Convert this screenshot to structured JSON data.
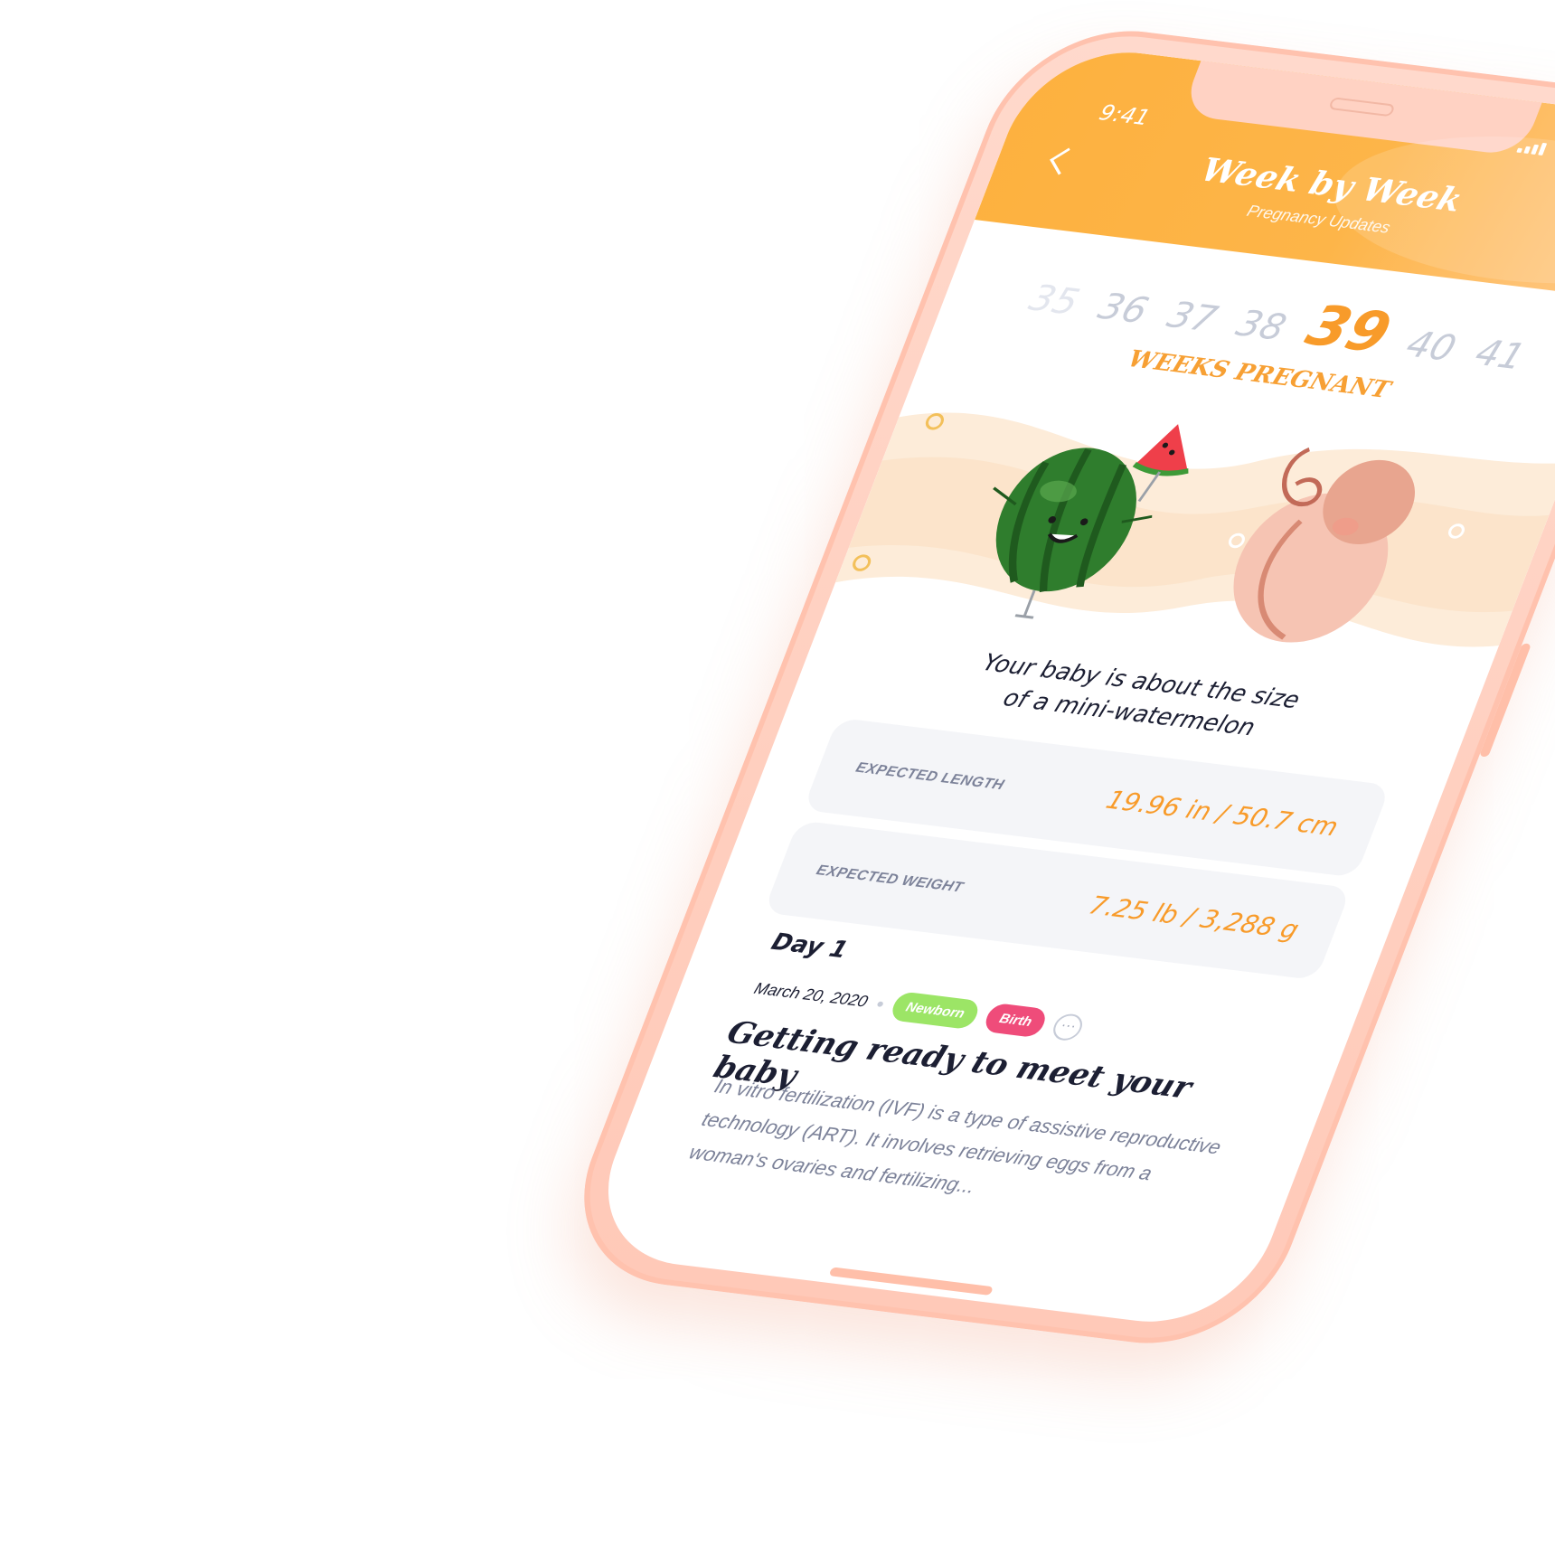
{
  "status_bar": {
    "time": "9:41"
  },
  "header": {
    "title": "Week by Week",
    "subtitle": "Pregnancy Updates"
  },
  "weeks": {
    "items": [
      "35",
      "36",
      "37",
      "38",
      "39",
      "40",
      "41"
    ],
    "current": "39",
    "label": "WEEKS PREGNANT"
  },
  "size": {
    "line1": "Your baby is about the size",
    "line2": "of a mini-watermelon"
  },
  "stats": [
    {
      "label": "EXPECTED LENGTH",
      "value": "19.96 in / 50.7 cm"
    },
    {
      "label": "EXPECTED WEIGHT",
      "value": "7.25 lb / 3,288 g"
    }
  ],
  "article": {
    "day": "Day 1",
    "date": "March 20, 2020",
    "tags": [
      "Newborn",
      "Birth"
    ],
    "title": "Getting ready to meet your baby",
    "body": "In vitro fertilization (IVF) is a type of assistive reproductive technology (ART). It involves retrieving eggs from a woman's ovaries and fertilizing..."
  },
  "colors": {
    "accent": "#f89b2a",
    "header": "#fdb13f",
    "phone_frame": "#ffd9cc",
    "tag_newborn": "#9ce566",
    "tag_birth": "#ef4c7a"
  }
}
